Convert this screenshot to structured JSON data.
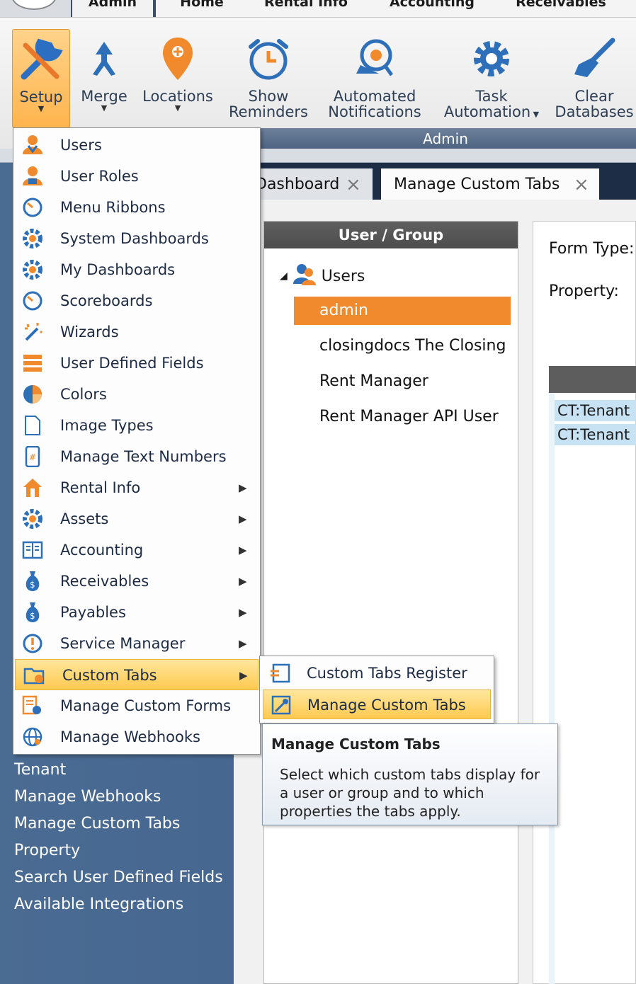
{
  "ribbon_tabs": [
    "Admin",
    "Home",
    "Rental Info",
    "Accounting",
    "Receivables"
  ],
  "ribbon": {
    "group_label": "Admin",
    "buttons": [
      {
        "label": "Setup",
        "icon": "wrench-icon"
      },
      {
        "label": "Merge",
        "icon": "merge-arrow-icon"
      },
      {
        "label": "Locations",
        "icon": "map-pin-icon"
      },
      {
        "label1": "Show",
        "label2": "Reminders",
        "icon": "alarm-clock-icon"
      },
      {
        "label1": "Automated",
        "label2": "Notifications",
        "icon": "notification-icon"
      },
      {
        "label1": "Task",
        "label2": "Automation",
        "icon": "gear-icon"
      },
      {
        "label1": "Clear",
        "label2": "Databases",
        "icon": "broom-icon"
      }
    ]
  },
  "doc_tabs": [
    {
      "label": "Dashboard"
    },
    {
      "label": "Manage Custom Tabs"
    }
  ],
  "setup_menu": [
    {
      "label": "Users",
      "icon": "users-icon"
    },
    {
      "label": "User Roles",
      "icon": "user-roles-icon"
    },
    {
      "label": "Menu Ribbons",
      "icon": "gauge-icon"
    },
    {
      "label": "System Dashboards",
      "icon": "dashboard-gear-icon"
    },
    {
      "label": "My Dashboards",
      "icon": "dashboard-gear-icon"
    },
    {
      "label": "Scoreboards",
      "icon": "gauge-icon"
    },
    {
      "label": "Wizards",
      "icon": "wand-icon"
    },
    {
      "label": "User Defined Fields",
      "icon": "fields-icon"
    },
    {
      "label": "Colors",
      "icon": "color-wheel-icon"
    },
    {
      "label": "Image Types",
      "icon": "document-icon"
    },
    {
      "label": "Manage Text Numbers",
      "icon": "phone-icon"
    },
    {
      "label": "Rental Info",
      "icon": "house-icon",
      "submenu": true
    },
    {
      "label": "Assets",
      "icon": "gear-icon",
      "submenu": true
    },
    {
      "label": "Accounting",
      "icon": "ledger-icon",
      "submenu": true
    },
    {
      "label": "Receivables",
      "icon": "money-bag-icon",
      "submenu": true
    },
    {
      "label": "Payables",
      "icon": "money-bag-icon",
      "submenu": true
    },
    {
      "label": "Service Manager",
      "icon": "alert-icon",
      "submenu": true
    },
    {
      "label": "Custom Tabs",
      "icon": "folder-gear-icon",
      "submenu": true,
      "highlighted": true
    },
    {
      "label": "Manage Custom Forms",
      "icon": "forms-gear-icon"
    },
    {
      "label": "Manage Webhooks",
      "icon": "globe-icon"
    }
  ],
  "custom_tabs_submenu": [
    {
      "label": "Custom Tabs Register",
      "icon": "register-icon"
    },
    {
      "label": "Manage Custom Tabs",
      "icon": "manage-tabs-icon",
      "highlighted": true
    }
  ],
  "tooltip": {
    "title": "Manage Custom Tabs",
    "body": "Select which custom tabs display for a user or group and to which properties the tabs apply."
  },
  "left_nav": [
    "Tenant",
    "Manage Webhooks",
    "Manage Custom Tabs",
    "Property",
    "Search User Defined Fields",
    "Available Integrations"
  ],
  "user_group": {
    "header": "User / Group",
    "root": "Users",
    "items": [
      "admin",
      "closingdocs The Closing D",
      "Rent Manager",
      "Rent Manager API User"
    ],
    "selected": "admin"
  },
  "form": {
    "form_type_label": "Form Type:",
    "property_label": "Property:",
    "grid_rows": [
      "CT:Tenant",
      "CT:Tenant"
    ]
  },
  "colors": {
    "accent_orange": "#f08a2c",
    "menu_highlight": "#ffc94f",
    "nav_blue": "#4a6b92"
  }
}
